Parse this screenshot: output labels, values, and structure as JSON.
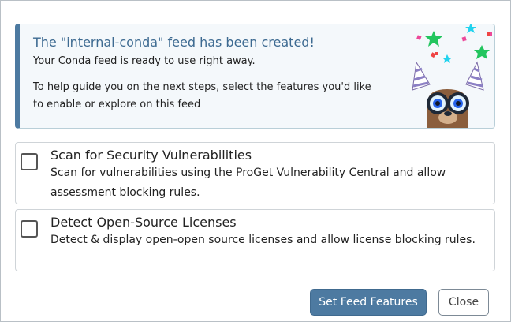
{
  "banner": {
    "title": "The \"internal-conda\" feed has been created!",
    "line1": "Your Conda feed is ready to use right away.",
    "line2": "To help guide you on the next steps, select the features you'd like to enable or explore on this feed"
  },
  "features": [
    {
      "title": "Scan for Security Vulnerabilities",
      "description": "Scan for vulnerabilities using the ProGet Vulnerability Central and allow assessment blocking rules.",
      "checked": false
    },
    {
      "title": "Detect Open-Source Licenses",
      "description": "Detect & display open-open source licenses and allow license blocking rules.",
      "checked": false
    }
  ],
  "actions": {
    "primary_label": "Set Feed Features",
    "close_label": "Close"
  },
  "colors": {
    "accent": "#4d7aa1",
    "banner_bg": "#f4f8fb"
  }
}
